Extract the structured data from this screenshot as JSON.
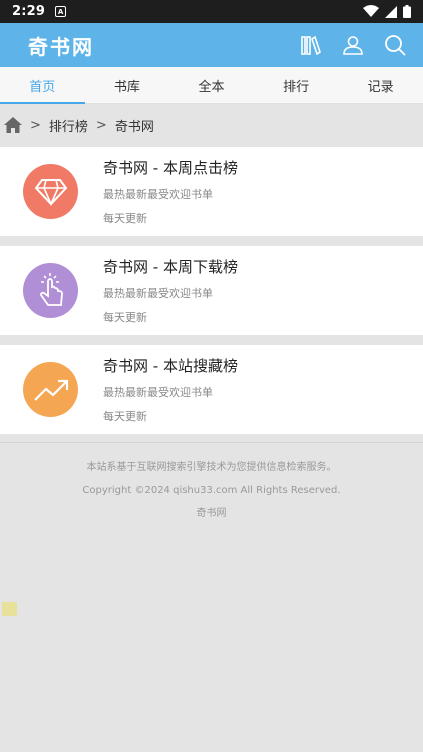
{
  "status_bar": {
    "time": "2:29",
    "notif_letter": "A"
  },
  "header": {
    "logo": "奇书网"
  },
  "icons": {
    "books": "books-icon",
    "user": "user-icon",
    "search": "search-icon",
    "home": "home-icon",
    "diamond": "diamond-icon",
    "touch": "touch-icon",
    "trend": "trend-up-icon"
  },
  "colors": {
    "header_bg": "#5eb4e8",
    "active_tab": "#46a8e8",
    "badge_red": "#f07a66",
    "badge_purple": "#b08fd6",
    "badge_orange": "#f4a653"
  },
  "tabs": [
    {
      "label": "首页",
      "active": true
    },
    {
      "label": "书库",
      "active": false
    },
    {
      "label": "全本",
      "active": false
    },
    {
      "label": "排行",
      "active": false
    },
    {
      "label": "记录",
      "active": false
    }
  ],
  "breadcrumb": {
    "sep1": ">",
    "level1": "排行榜",
    "sep2": ">",
    "level2": "奇书网"
  },
  "items": [
    {
      "title": "奇书网 - 本周点击榜",
      "subtitle": "最热最新最受欢迎书单",
      "update": "每天更新"
    },
    {
      "title": "奇书网 - 本周下载榜",
      "subtitle": "最热最新最受欢迎书单",
      "update": "每天更新"
    },
    {
      "title": "奇书网 - 本站搜藏榜",
      "subtitle": "最热最新最受欢迎书单",
      "update": "每天更新"
    }
  ],
  "footer": {
    "line1": "本站系基于互联网搜索引擎技术为您提供信息检索服务。",
    "line2": "Copyright ©2024 qishu33.com All Rights Reserved.",
    "line3": "奇书网"
  }
}
